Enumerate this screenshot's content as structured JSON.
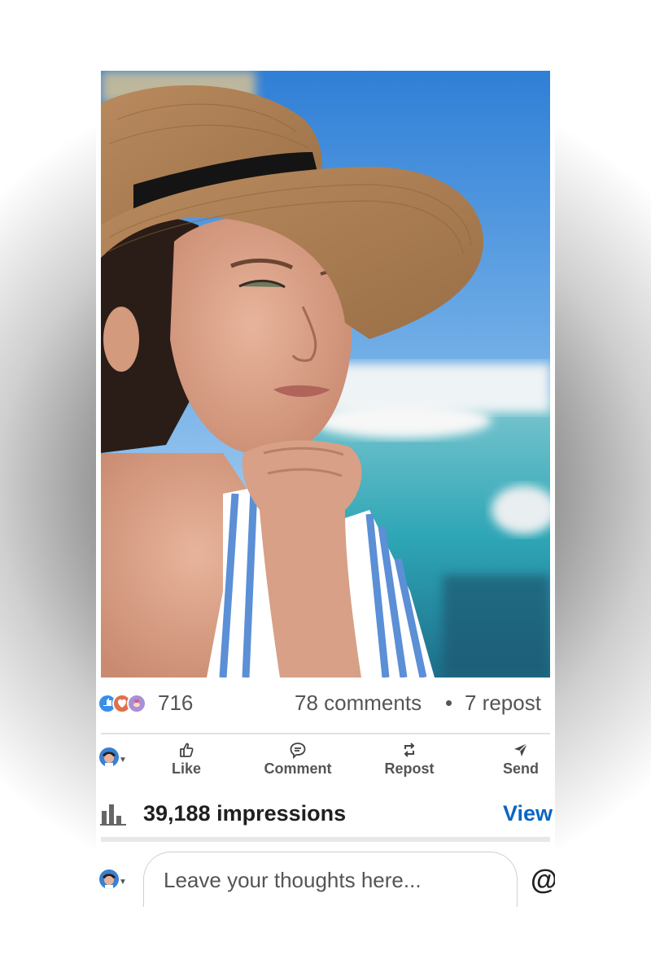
{
  "post": {
    "reactions": {
      "icons": [
        "like-reaction-icon",
        "love-reaction-icon",
        "support-reaction-icon"
      ],
      "count": "716"
    },
    "comments": "78 comments",
    "separator": "•",
    "reposts": "7 repost"
  },
  "actions": {
    "like": "Like",
    "comment": "Comment",
    "repost": "Repost",
    "send": "Send"
  },
  "analytics": {
    "impressions": "39,188 impressions",
    "view_link": "View"
  },
  "comment_box": {
    "placeholder": "Leave your thoughts here...",
    "mention_icon": "@"
  },
  "colors": {
    "accent": "#0a66c2",
    "muted_text": "#555555",
    "sky": "#3f86d9",
    "sea": "#2fa7b5"
  }
}
